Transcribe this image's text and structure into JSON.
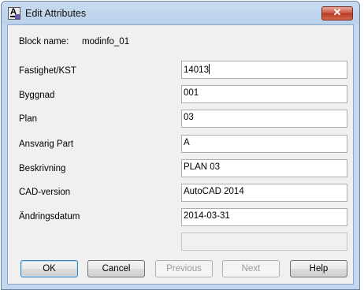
{
  "window": {
    "title": "Edit Attributes",
    "close_symbol": "✕"
  },
  "block": {
    "label": "Block name:",
    "value": "modinfo_01"
  },
  "attributes": [
    {
      "label": "Fastighet/KST",
      "value": "14013"
    },
    {
      "label": "Byggnad",
      "value": " 001"
    },
    {
      "label": "Plan",
      "value": "03"
    },
    {
      "label": "Ansvarig Part",
      "value": "A"
    },
    {
      "label": "Beskrivning",
      "value": "PLAN 03"
    },
    {
      "label": "CAD-version",
      "value": "AutoCAD 2014"
    },
    {
      "label": "Ändringsdatum",
      "value": "2014-03-31"
    }
  ],
  "empty_field": {
    "value": ""
  },
  "buttons": {
    "ok": "OK",
    "cancel": "Cancel",
    "previous": "Previous",
    "next": "Next",
    "help": "Help"
  },
  "icons": {
    "app": "autocad-attribute-icon",
    "close": "close-icon"
  }
}
